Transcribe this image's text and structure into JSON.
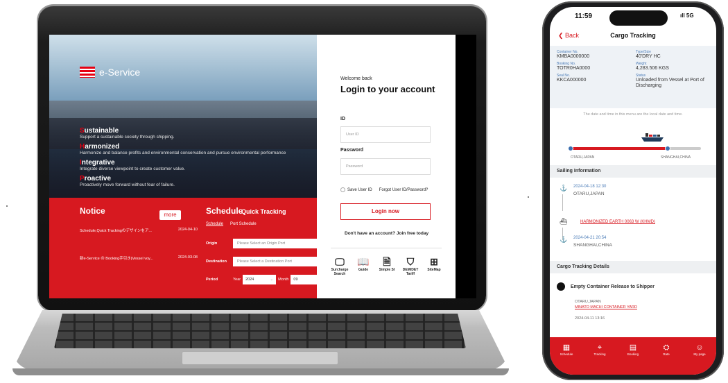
{
  "laptop": {
    "brand": "e-Service",
    "values": [
      {
        "cap": "S",
        "rest": "ustainable",
        "desc": "Support a sustainable society through shipping."
      },
      {
        "cap": "H",
        "rest": "armonized",
        "desc": "Harmonize and balance profits and environmental conservation and pursue environmental performance"
      },
      {
        "cap": "I",
        "rest": "ntegrative",
        "desc": "Integrate diverse viewpoint to create customer value."
      },
      {
        "cap": "P",
        "rest": "roactive",
        "desc": "Proactively move forward without fear of failure."
      }
    ],
    "notice": {
      "title": "Notice",
      "more": "more",
      "items": [
        {
          "text": "Schedule,Quick Trackingのデザインをア...",
          "date": "2024-04-10"
        },
        {
          "text": "新e-Service の Booking手引き(Vessel voy...",
          "date": "2024-03-08"
        }
      ]
    },
    "schedule": {
      "title": "Schedule",
      "quick": "Quick Tracking",
      "tabs": [
        "Schedule",
        "Port Schedule"
      ],
      "origin_label": "Origin",
      "origin_placeholder": "Please Select an Origin Port",
      "destination_label": "Destination",
      "destination_placeholder": "Please Select a Destination Port",
      "period_label": "Period",
      "year_label": "Year",
      "year": "2024",
      "month_label": "Month",
      "month": "09"
    },
    "login": {
      "welcome": "Welcome back",
      "title": "Login to your account",
      "id_label": "ID",
      "id_placeholder": "User ID",
      "password_label": "Password",
      "password_placeholder": "Password",
      "save_user_id": "Save User ID",
      "forgot": "Forgot User ID/Password?",
      "login_btn": "Login now",
      "signup_prefix": "Don't have an account?",
      "signup_link": "Join free today",
      "quick_links": [
        {
          "icon": "monitor-icon",
          "label": "Surcharge Search"
        },
        {
          "icon": "book-icon",
          "label": "Guide"
        },
        {
          "icon": "document-icon",
          "label": "Simple SI"
        },
        {
          "icon": "tariff-icon",
          "label": "DEM/DET Tariff"
        },
        {
          "icon": "sitemap-icon",
          "label": "SiteMap"
        }
      ]
    }
  },
  "phone": {
    "time": "11:59",
    "signal": "ıll 5G",
    "back": "Back",
    "title": "Cargo Tracking",
    "info": [
      {
        "key": "Container No.",
        "value": "KMBA0000000"
      },
      {
        "key": "Type/Size",
        "value": "40'DRY HC"
      },
      {
        "key": "Booking No.",
        "value": "TOTR0HA0000"
      },
      {
        "key": "Weight",
        "value": "4,283.506 KGS"
      },
      {
        "key": "Seal No.",
        "value": "KKCA000000"
      },
      {
        "key": "Status",
        "value": "Unloaded from Vessel at Port of Discharging"
      }
    ],
    "note": "The date and time in this menu are the local date and time.",
    "route_from": "OTARU,JAPAN",
    "route_to": "SHANGHAI,CHINA",
    "sailing_title": "Sailing Information",
    "stops": [
      {
        "date": "2024-04-18 12:30",
        "place": "OTARU,JAPAN"
      },
      {
        "date": "2024-04-21 20:54",
        "place": "SHANGHAI,CHINA"
      }
    ],
    "vessel": "HARMONIZED EARTH 0063 W (KHMD)",
    "details_title": "Cargo Tracking Details",
    "detail_step": "Empty Container Release to Shipper",
    "detail_place": "OTARU,JAPAN",
    "detail_yard": "MINATO MACHI CONTAINER YARD",
    "detail_time": "2024-04-11 13:16",
    "tabs": [
      "Schedule",
      "Tracking",
      "Booking",
      "Rate",
      "My page"
    ],
    "accent": "#d71920"
  }
}
